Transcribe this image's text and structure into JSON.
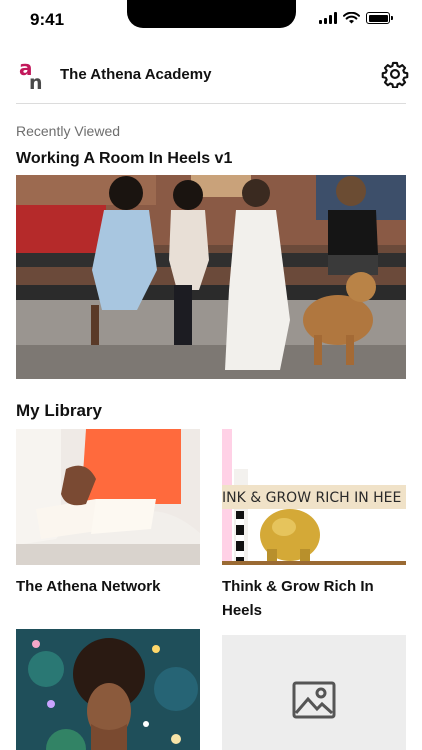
{
  "status_bar": {
    "time": "9:41",
    "icons": [
      "cellular-signal-icon",
      "wifi-icon",
      "battery-icon"
    ]
  },
  "header": {
    "logo_letters": "an",
    "title": "The Athena Academy",
    "settings_icon": "gear-icon"
  },
  "colors": {
    "brand_magenta": "#c2185b",
    "brand_gray": "#4a4a4a",
    "divider": "#dcdcdc",
    "placeholder_bg": "#ededed"
  },
  "recently_viewed": {
    "label": "Recently Viewed",
    "title": "Working A Room In Heels v1",
    "image": "photo: four women sitting on a park bench with a dog"
  },
  "library": {
    "heading": "My Library",
    "items": [
      {
        "title": "The Athena Network",
        "image": "photo: woman in coral top reading an open book"
      },
      {
        "title": "Think & Grow Rich In Heels",
        "banner_text": "INK & GROW RICH IN HEE",
        "image": "photo: gold piggy bank with books"
      },
      {
        "title": "",
        "image": "photo: smiling woman with confetti"
      },
      {
        "title": "",
        "image": "image-placeholder-icon"
      }
    ]
  }
}
